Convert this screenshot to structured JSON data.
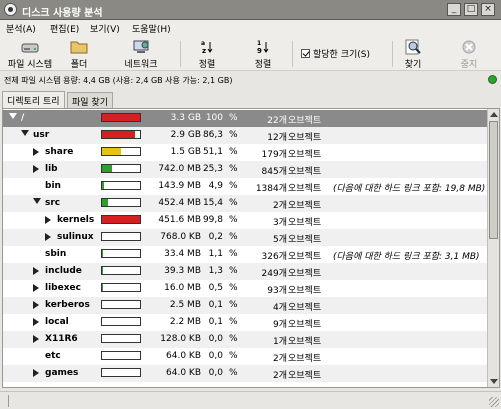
{
  "window": {
    "title": "디스크 사용량 분석"
  },
  "menu": [
    {
      "label": "분석(A)"
    },
    {
      "label": "편집(E)"
    },
    {
      "label": "보기(V)"
    },
    {
      "label": "도움말(H)"
    }
  ],
  "toolbar": {
    "filesystem": "파일 시스템",
    "folder": "폴더",
    "network": "네트워크",
    "sort_name": "정렬",
    "sort_size": "정렬",
    "allocated_size": "할당한 크기(S)",
    "find": "찾기",
    "stop": "중지"
  },
  "info": {
    "text": "전체 파일 시스템 용량: 4,4 GB (사용: 2,4 GB 사용 가능: 2,1 GB)"
  },
  "tabs": [
    {
      "label": "디렉토리 트리"
    },
    {
      "label": "파일 찾기"
    }
  ],
  "colors": {
    "red": "#d42020",
    "yellow": "#e8c21a",
    "green": "#2f9f2f",
    "selected": "#8a8a8a"
  },
  "rows": [
    {
      "name": "/",
      "size": "3.3 GB",
      "pct": "100",
      "objs": "22개",
      "label": "오브젝트",
      "hardlink": "",
      "fill": 1.0,
      "color": "#d42020"
    },
    {
      "name": "usr",
      "size": "2.9 GB",
      "pct": "86,3",
      "objs": "12개",
      "label": "오브젝트",
      "hardlink": "",
      "fill": 0.863,
      "color": "#d42020"
    },
    {
      "name": "share",
      "size": "1.5 GB",
      "pct": "51,1",
      "objs": "179개",
      "label": "오브젝트",
      "hardlink": "",
      "fill": 0.511,
      "color": "#e8c21a"
    },
    {
      "name": "lib",
      "size": "742.0 MB",
      "pct": "25,3",
      "objs": "845개",
      "label": "오브젝트",
      "hardlink": "",
      "fill": 0.253,
      "color": "#2f9f2f"
    },
    {
      "name": "bin",
      "size": "143.9 MB",
      "pct": "4,9",
      "objs": "1384개",
      "label": "오브젝트",
      "hardlink": "(다음에 대한 하드 링크 포함: 19,8 MB)",
      "fill": 0.049,
      "color": "#2f9f2f"
    },
    {
      "name": "src",
      "size": "452.4 MB",
      "pct": "15,4",
      "objs": "2개",
      "label": "오브젝트",
      "hardlink": "",
      "fill": 0.154,
      "color": "#2f9f2f"
    },
    {
      "name": "kernels",
      "size": "451.6 MB",
      "pct": "99,8",
      "objs": "3개",
      "label": "오브젝트",
      "hardlink": "",
      "fill": 0.998,
      "color": "#d42020"
    },
    {
      "name": "sulinux",
      "size": "768.0 KB",
      "pct": "0,2",
      "objs": "5개",
      "label": "오브젝트",
      "hardlink": "",
      "fill": 0.002,
      "color": "#2f9f2f"
    },
    {
      "name": "sbin",
      "size": "33.4 MB",
      "pct": "1,1",
      "objs": "326개",
      "label": "오브젝트",
      "hardlink": "(다음에 대한 하드 링크 포함: 3,1 MB)",
      "fill": 0.011,
      "color": "#2f9f2f"
    },
    {
      "name": "include",
      "size": "39.3 MB",
      "pct": "1,3",
      "objs": "249개",
      "label": "오브젝트",
      "hardlink": "",
      "fill": 0.013,
      "color": "#2f9f2f"
    },
    {
      "name": "libexec",
      "size": "16.0 MB",
      "pct": "0,5",
      "objs": "93개",
      "label": "오브젝트",
      "hardlink": "",
      "fill": 0.005,
      "color": "#2f9f2f"
    },
    {
      "name": "kerberos",
      "size": "2.5 MB",
      "pct": "0,1",
      "objs": "4개",
      "label": "오브젝트",
      "hardlink": "",
      "fill": 0.001,
      "color": "#2f9f2f"
    },
    {
      "name": "local",
      "size": "2.2 MB",
      "pct": "0,1",
      "objs": "9개",
      "label": "오브젝트",
      "hardlink": "",
      "fill": 0.001,
      "color": "#2f9f2f"
    },
    {
      "name": "X11R6",
      "size": "128.0 KB",
      "pct": "0,0",
      "objs": "1개",
      "label": "오브젝트",
      "hardlink": "",
      "fill": 0.0,
      "color": "#2f9f2f"
    },
    {
      "name": "etc",
      "size": "64.0 KB",
      "pct": "0,0",
      "objs": "2개",
      "label": "오브젝트",
      "hardlink": "",
      "fill": 0.0,
      "color": "#2f9f2f"
    },
    {
      "name": "games",
      "size": "64.0 KB",
      "pct": "0,0",
      "objs": "2개",
      "label": "오브젝트",
      "hardlink": "",
      "fill": 0.0,
      "color": "#2f9f2f"
    }
  ],
  "pct_sign": "%",
  "status": {
    "text": ""
  }
}
